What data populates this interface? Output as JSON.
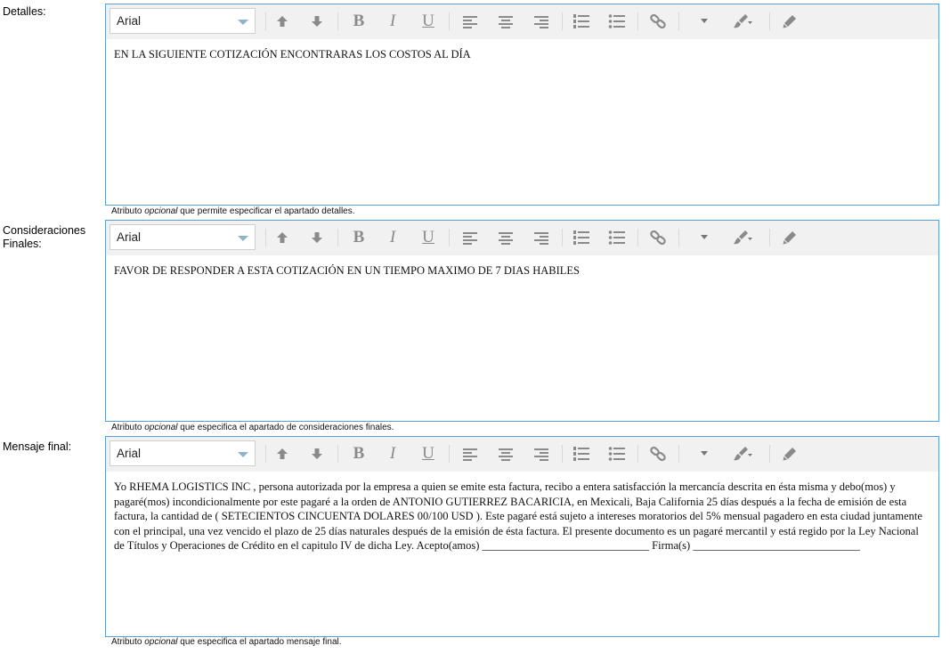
{
  "font_default": "Arial",
  "toolbar": {
    "bold": "B",
    "italic": "I",
    "underline": "U"
  },
  "fields": [
    {
      "label": "Detalles:",
      "content": "EN LA SIGUIENTE COTIZACIÓN ENCONTRARAS LOS COSTOS AL DÍA",
      "hint_pre": "Atributo",
      "hint_em": "opcional",
      "hint_post": "que permite especificar el apartado detalles."
    },
    {
      "label": "Consideraciones Finales:",
      "content": "FAVOR DE RESPONDER A ESTA COTIZACIÓN EN UN TIEMPO MAXIMO DE 7 DIAS HABILES",
      "hint_pre": "Atributo",
      "hint_em": "opcional",
      "hint_post": "que especifica el apartado de consideraciones finales."
    },
    {
      "label": "Mensaje final:",
      "content": "Yo RHEMA LOGISTICS INC , persona autorizada por la empresa a quien se emite esta factura, recibo a entera satisfacción la mercancía descrita en ésta misma y debo(mos) y pagaré(mos) incondicionalmente por este pagaré a la orden de ANTONIO GUTIERREZ BACARICIA, en Mexicali, Baja California 25 días después a la fecha de emisión de esta factura, la cantidad de ( SETECIENTOS CINCUENTA DOLARES 00/100 USD ). Este pagaré está sujeto a intereses moratorios del 5% mensual pagadero en esta ciudad juntamente con el principal, una vez vencido el plazo de 25 días naturales después de la emisión de ésta factura. El presente documento es un pagaré mercantil y está regido por la Ley Nacional de Títulos y Operaciones de Crédito en el capitulo IV de dicha Ley. Acepto(amos) ______________________________ Firma(s) ______________________________",
      "hint_pre": "Atributo",
      "hint_em": "opcional",
      "hint_post": "que especifica el apartado mensaje final."
    }
  ]
}
